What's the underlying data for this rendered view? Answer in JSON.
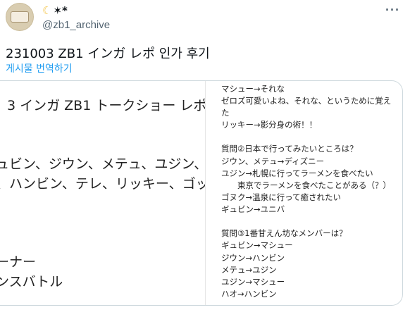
{
  "author": {
    "display_name": "✶*",
    "moon_icon": "crescent-moon",
    "handle": "@zb1_archive"
  },
  "tweet": {
    "text": "231003 ZB1 インガ レポ 인가 후기",
    "translate_label": "게시물 번역하기"
  },
  "media": {
    "left_image": {
      "lines": [
        "3 インガ ZB1 トークショー レポ",
        "゚ュビン、ジウン、メテュ、ユジン、",
        "、ハンビン、テレ、リッキー、ゴッ",
        "ーナー",
        "ンスバトル"
      ]
    },
    "right_image": {
      "lines": [
        "マシュー→それな",
        "ゼロズ可愛いよね、それな、というために覚え",
        "た",
        "リッキー→影分身の術！！",
        "",
        "質問②日本で行ってみたいところは？",
        "ジウン、メテュ→ディズニー",
        "ユジン→札幌に行ってラーメンを食べたい",
        "　　東京でラーメンを食べたことがある（？）",
        "ゴヌク→温泉に行って癒されたい",
        "ギュビン→ユニバ",
        "",
        "質問③1番甘えん坊なメンバーは？",
        "ギュビン→マシュー",
        "ジウン→ハンビン",
        "メテュ→ユジン",
        "ユジン→マシュー",
        "ハオ→ハンビン"
      ]
    }
  },
  "icons": {
    "more": "more-options-icon",
    "avatar": "avatar-logo"
  },
  "colors": {
    "link": "#1d9bf0",
    "secondary_text": "#536471",
    "moon": "#f3c548"
  }
}
